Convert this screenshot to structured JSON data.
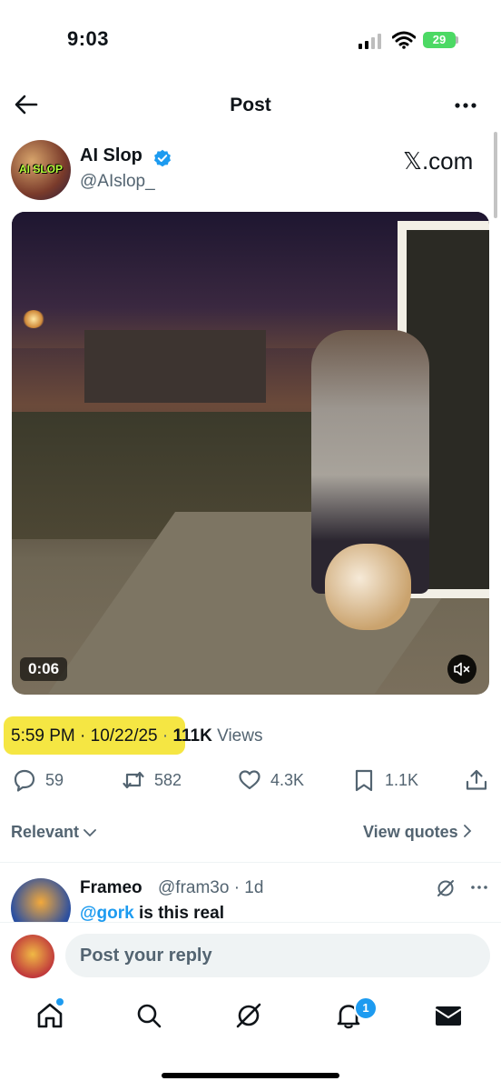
{
  "status_bar": {
    "time": "9:03",
    "battery": "29"
  },
  "nav": {
    "title": "Post"
  },
  "author": {
    "avatar_text": "AI SLOP",
    "name": "AI Slop",
    "handle": "@AIslop_",
    "watermark": "𝕏.com"
  },
  "media": {
    "duration": "0:06"
  },
  "meta": {
    "time": "5:59 PM",
    "sep": " · ",
    "date": "10/22/25",
    "views_sep": " · ",
    "views_count": "111K",
    "views_label": " Views"
  },
  "actions": {
    "replies": "59",
    "reposts": "582",
    "likes": "4.3K",
    "bookmarks": "1.1K"
  },
  "sort": {
    "relevant": "Relevant",
    "view_quotes": "View quotes"
  },
  "reply": {
    "name": "Frameo",
    "handle": "@fram3o · 1d",
    "mention": "@gork",
    "text": " is this real"
  },
  "composer": {
    "placeholder": "Post your reply"
  },
  "tabbar": {
    "notifications_badge": "1"
  },
  "colors": {
    "accent": "#1d9bf0",
    "highlight": "#f5e643",
    "battery": "#4cd964"
  },
  "icons": [
    "back-arrow-icon",
    "more-icon",
    "verified-icon",
    "mute-icon",
    "reply-icon",
    "repost-icon",
    "heart-icon",
    "bookmark-icon",
    "share-icon",
    "chevron-down-icon",
    "chevron-right-icon",
    "grok-icon",
    "home-icon",
    "search-icon",
    "bell-icon",
    "mail-icon"
  ]
}
